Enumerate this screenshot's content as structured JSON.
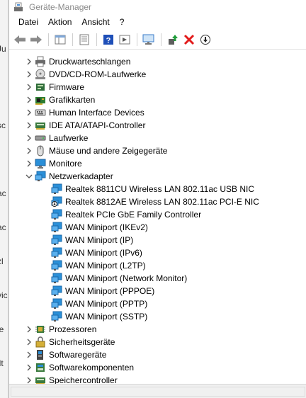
{
  "background_window": {
    "fragments": [
      "Ju",
      "sc",
      "ac",
      "ac",
      "zl",
      "vic",
      "le",
      "ilt"
    ]
  },
  "window": {
    "title": "Geräte-Manager"
  },
  "menu": {
    "items": [
      "Datei",
      "Aktion",
      "Ansicht",
      "?"
    ]
  },
  "toolbar": {
    "buttons": [
      "back-arrow-icon",
      "forward-arrow-icon",
      "show-hide-console-tree-icon",
      "properties-icon",
      "help-icon",
      "action-pane-icon",
      "monitor-scan-icon",
      "update-driver-icon",
      "uninstall-icon",
      "disable-device-icon"
    ]
  },
  "tree": {
    "nodes": [
      {
        "label": "Druckwarteschlangen",
        "expanded": false,
        "icon": "printer-icon"
      },
      {
        "label": "DVD/CD-ROM-Laufwerke",
        "expanded": false,
        "icon": "disc-drive-icon"
      },
      {
        "label": "Firmware",
        "expanded": false,
        "icon": "firmware-icon"
      },
      {
        "label": "Grafikkarten",
        "expanded": false,
        "icon": "graphics-card-icon"
      },
      {
        "label": "Human Interface Devices",
        "expanded": false,
        "icon": "hid-icon"
      },
      {
        "label": "IDE ATA/ATAPI-Controller",
        "expanded": false,
        "icon": "ide-controller-icon"
      },
      {
        "label": "Laufwerke",
        "expanded": false,
        "icon": "disk-drive-icon"
      },
      {
        "label": "Mäuse und andere Zeigegeräte",
        "expanded": false,
        "icon": "mouse-icon"
      },
      {
        "label": "Monitore",
        "expanded": false,
        "icon": "monitor-icon"
      },
      {
        "label": "Netzwerkadapter",
        "expanded": true,
        "icon": "network-adapter-icon"
      },
      {
        "label": "Prozessoren",
        "expanded": false,
        "icon": "processor-icon"
      },
      {
        "label": "Sicherheitsgeräte",
        "expanded": false,
        "icon": "security-device-icon"
      },
      {
        "label": "Softwaregeräte",
        "expanded": false,
        "icon": "software-device-icon"
      },
      {
        "label": "Softwarekomponenten",
        "expanded": false,
        "icon": "software-component-icon"
      },
      {
        "label": "Speichercontroller",
        "expanded": false,
        "icon": "storage-controller-icon"
      }
    ],
    "network_adapters": [
      {
        "label": "Realtek 8811CU Wireless LAN 802.11ac USB NIC",
        "icon": "network-adapter-icon"
      },
      {
        "label": "Realtek 8812AE Wireless LAN 802.11ac PCI-E NIC",
        "icon": "network-adapter-disabled-icon"
      },
      {
        "label": "Realtek PCIe GbE Family Controller",
        "icon": "network-adapter-icon"
      },
      {
        "label": "WAN Miniport (IKEv2)",
        "icon": "network-adapter-icon"
      },
      {
        "label": "WAN Miniport (IP)",
        "icon": "network-adapter-icon"
      },
      {
        "label": "WAN Miniport (IPv6)",
        "icon": "network-adapter-icon"
      },
      {
        "label": "WAN Miniport (L2TP)",
        "icon": "network-adapter-icon"
      },
      {
        "label": "WAN Miniport (Network Monitor)",
        "icon": "network-adapter-icon"
      },
      {
        "label": "WAN Miniport (PPPOE)",
        "icon": "network-adapter-icon"
      },
      {
        "label": "WAN Miniport (PPTP)",
        "icon": "network-adapter-icon"
      },
      {
        "label": "WAN Miniport (SSTP)",
        "icon": "network-adapter-icon"
      }
    ]
  },
  "colors": {
    "accent_blue": "#1e6fd0",
    "network_blue": "#2a8fd8",
    "uninstall_red": "#e21b1b",
    "update_green": "#1f9d3a"
  }
}
